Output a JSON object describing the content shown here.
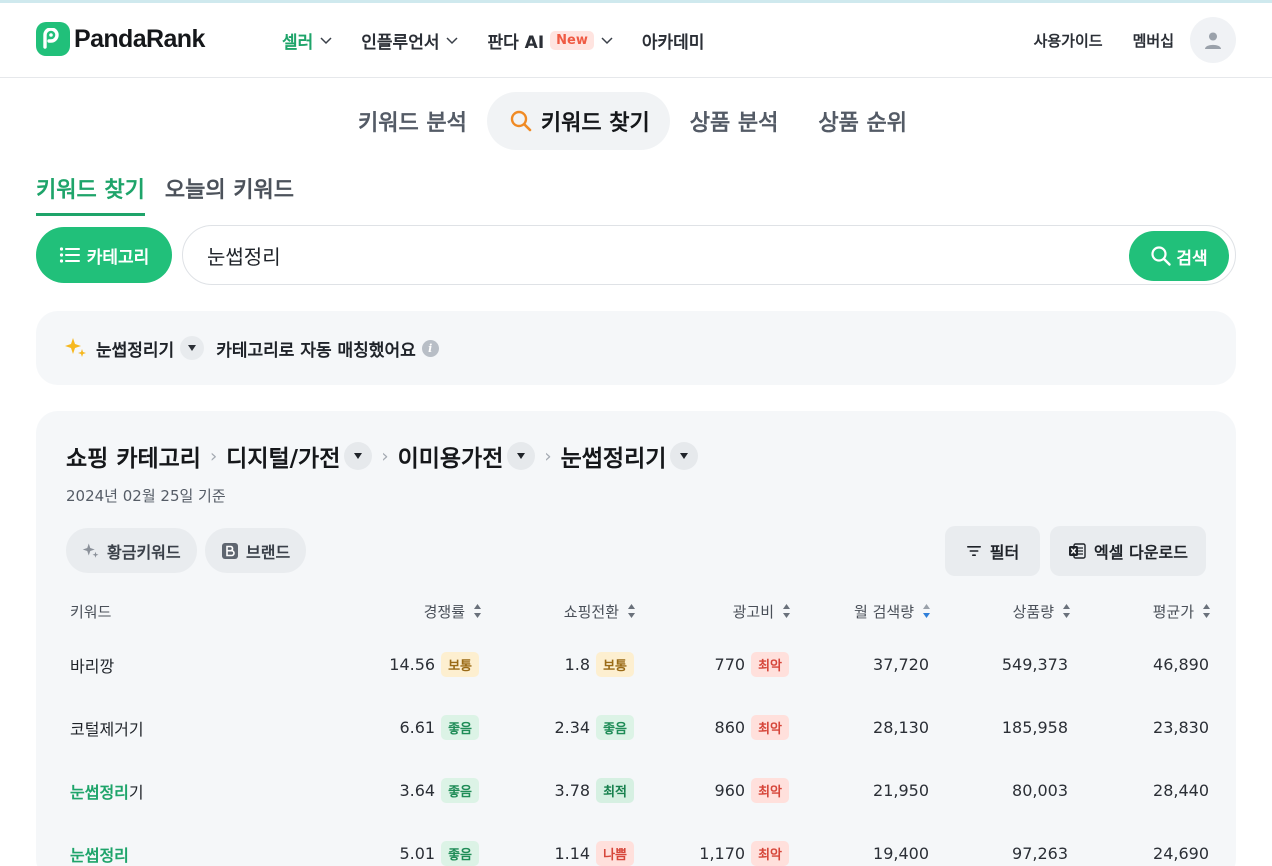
{
  "header": {
    "logo_text": "PandaRank",
    "nav": [
      {
        "label": "셀러",
        "has_dropdown": true,
        "active": true
      },
      {
        "label": "인플루언서",
        "has_dropdown": true
      },
      {
        "label": "판다 AI",
        "badge": "New",
        "has_dropdown": true
      },
      {
        "label": "아카데미",
        "has_dropdown": false
      }
    ],
    "right_links": [
      "사용가이드",
      "멤버십"
    ]
  },
  "main_tabs": [
    {
      "label": "키워드 분석"
    },
    {
      "label": "키워드 찾기",
      "active": true
    },
    {
      "label": "상품 분석"
    },
    {
      "label": "상품 순위"
    }
  ],
  "sub_tabs": [
    {
      "label": "키워드 찾기",
      "active": true
    },
    {
      "label": "오늘의 키워드"
    }
  ],
  "search": {
    "category_label": "카테고리",
    "value": "눈썹정리",
    "button_label": "검색"
  },
  "notice": {
    "keyword": "눈썹정리기",
    "text": "카테고리로 자동 매칭했어요",
    "info_symbol": "i"
  },
  "result": {
    "breadcrumb": [
      "쇼핑 카테고리",
      "디지털/가전",
      "이미용가전",
      "눈썹정리기"
    ],
    "date": "2024년 02월 25일 기준",
    "chips": {
      "gold": "황금키워드",
      "brand": "브랜드"
    },
    "buttons": {
      "filter": "필터",
      "excel": "엑셀 다운로드"
    },
    "columns": [
      "키워드",
      "경쟁률",
      "쇼핑전환",
      "광고비",
      "월 검색량",
      "상품량",
      "평균가"
    ],
    "rows": [
      {
        "kw_hl": "",
        "kw_rest": "바리깡",
        "competition": "14.56",
        "competition_tag": "보통",
        "conversion": "1.8",
        "conversion_tag": "보통",
        "ad_cost": "770",
        "ad_tag": "최악",
        "monthly": "37,720",
        "products": "549,373",
        "avg_price": "46,890"
      },
      {
        "kw_hl": "",
        "kw_rest": "코털제거기",
        "competition": "6.61",
        "competition_tag": "좋음",
        "conversion": "2.34",
        "conversion_tag": "좋음",
        "ad_cost": "860",
        "ad_tag": "최악",
        "monthly": "28,130",
        "products": "185,958",
        "avg_price": "23,830"
      },
      {
        "kw_hl": "눈썹정리",
        "kw_rest": "기",
        "competition": "3.64",
        "competition_tag": "좋음",
        "conversion": "3.78",
        "conversion_tag": "최적",
        "ad_cost": "960",
        "ad_tag": "최악",
        "monthly": "21,950",
        "products": "80,003",
        "avg_price": "28,440"
      },
      {
        "kw_hl": "눈썹정리",
        "kw_rest": "",
        "competition": "5.01",
        "competition_tag": "좋음",
        "conversion": "1.14",
        "conversion_tag": "나쁨",
        "ad_cost": "1,170",
        "ad_tag": "최악",
        "monthly": "19,400",
        "products": "97,263",
        "avg_price": "24,690"
      }
    ]
  },
  "colors": {
    "brand_green": "#21c07a",
    "active_text": "#1ea46a",
    "new_badge": "#ef5a43"
  },
  "icons": [
    "panda-logo-icon",
    "chevron-down-icon",
    "user-icon",
    "search-icon",
    "list-icon",
    "sparkle-icon",
    "caret-down-icon",
    "info-icon",
    "sort-icon",
    "filter-icon",
    "excel-icon",
    "brand-b-icon"
  ]
}
